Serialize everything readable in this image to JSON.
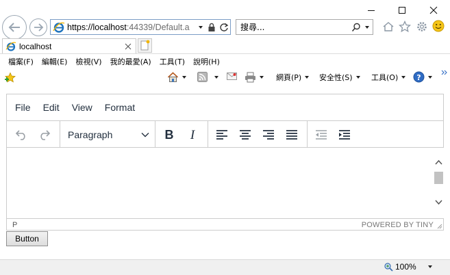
{
  "window": {
    "controls": [
      "minimize-icon",
      "maximize-icon",
      "close-icon"
    ]
  },
  "address_bar": {
    "url_main": "https://localhost",
    "url_rest": ":44339/Default.a"
  },
  "search_box": {
    "placeholder": "搜尋..."
  },
  "tab": {
    "title": "localhost"
  },
  "menubar": {
    "items": [
      "檔案(F)",
      "編輯(E)",
      "檢視(V)",
      "我的最愛(A)",
      "工具(T)",
      "說明(H)"
    ]
  },
  "command_bar": {
    "page_label": "網頁(P)",
    "safety_label": "安全性(S)",
    "tools_label": "工具(O)"
  },
  "editor": {
    "menu": [
      "File",
      "Edit",
      "View",
      "Format"
    ],
    "block_format": "Paragraph",
    "status_path": "P",
    "branding": "POWERED BY TINY"
  },
  "page": {
    "button_label": "Button"
  },
  "status_bar": {
    "zoom": "100%"
  },
  "colors": {
    "ie_blue": "#1e73be",
    "editor_text": "#222f3e",
    "border": "#cccccc"
  }
}
